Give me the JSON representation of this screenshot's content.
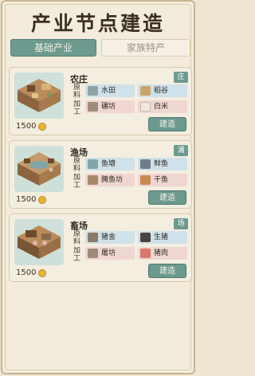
{
  "title": "产业节点建造",
  "tabs": {
    "active": "基础产业",
    "inactive": "家族特产"
  },
  "labels": {
    "material": "原料",
    "process": "加工"
  },
  "cards": [
    {
      "name": "农庄",
      "tag": "庄",
      "cost": "1500",
      "raw": [
        "水田",
        "稻谷"
      ],
      "proc": [
        "碾坊",
        "白米"
      ],
      "button": "建造"
    },
    {
      "name": "渔场",
      "tag": "浦",
      "cost": "1500",
      "raw": [
        "鱼塘",
        "鲜鱼"
      ],
      "proc": [
        "腌鱼坊",
        "干鱼"
      ],
      "button": "建造"
    },
    {
      "name": "畜场",
      "tag": "场",
      "cost": "1500",
      "raw": [
        "猪舍",
        "生猪"
      ],
      "proc": [
        "屠坊",
        "猪肉"
      ],
      "button": "建造"
    }
  ],
  "colors": {
    "accent": "#6c9a8f",
    "background": "#efe6d2",
    "coin": "#e8b53a"
  }
}
